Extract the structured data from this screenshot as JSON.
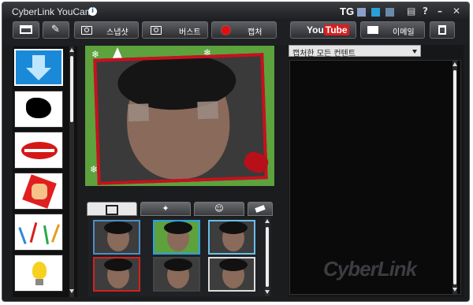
{
  "app": {
    "title": "CyberLink YouCam",
    "info_glyph": "i"
  },
  "titlebar": {
    "tg_label": "TG",
    "swatches": [
      "#8aa0c8",
      "#2a9fd8",
      "#6a8aa8"
    ],
    "settings_glyph": "▤",
    "help_glyph": "?",
    "minimize_glyph": "–",
    "close_glyph": "✕"
  },
  "toolbar": {
    "snapshot_label": "스냅샷",
    "burst_label": "버스트",
    "capture_label": "캡처",
    "youtube_label_you": "You",
    "youtube_label_tube": "Tube",
    "email_label": "이메일"
  },
  "right_panel": {
    "filter_selected": "캡처한 모든 컨텐트",
    "watermark": "CyberLink"
  },
  "colors": {
    "accent_green": "#5da23d",
    "frame_red": "#c8101e",
    "capture_red": "#e01010"
  },
  "icons": {
    "left": [
      "download-arrow-icon",
      "bird-icon",
      "lips-icon",
      "punch-icon",
      "confetti-icon",
      "lightbulb-icon"
    ]
  }
}
